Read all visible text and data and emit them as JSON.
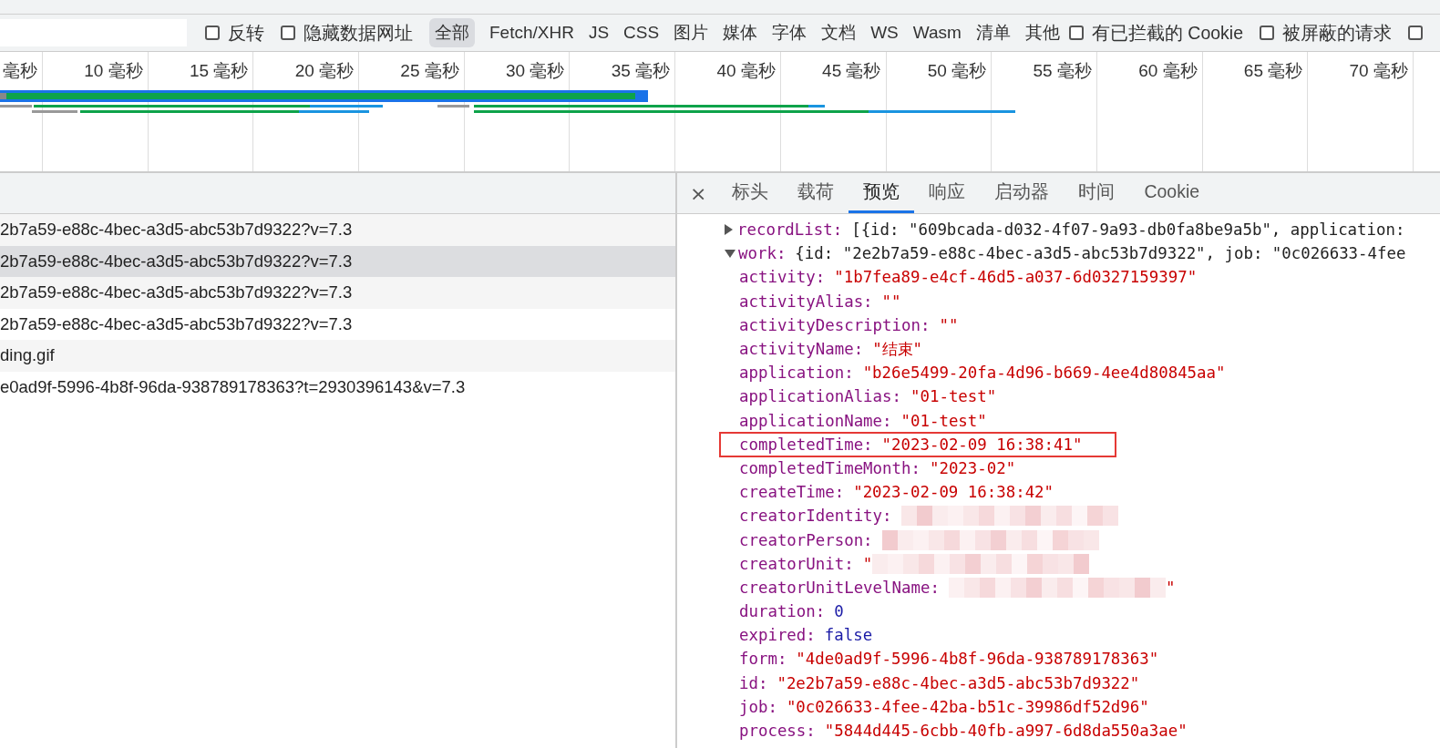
{
  "filter_bar": {
    "options": [
      {
        "kind": "checkbox",
        "label": "反转",
        "checked": false
      },
      {
        "kind": "checkbox",
        "label": "隐藏数据网址",
        "checked": false
      },
      {
        "kind": "type",
        "label": "全部",
        "selected": true
      },
      {
        "kind": "type",
        "label": "Fetch/XHR",
        "selected": false
      },
      {
        "kind": "type",
        "label": "JS",
        "selected": false
      },
      {
        "kind": "type",
        "label": "CSS",
        "selected": false
      },
      {
        "kind": "type",
        "label": "图片",
        "selected": false
      },
      {
        "kind": "type",
        "label": "媒体",
        "selected": false
      },
      {
        "kind": "type",
        "label": "字体",
        "selected": false
      },
      {
        "kind": "type",
        "label": "文档",
        "selected": false
      },
      {
        "kind": "type",
        "label": "WS",
        "selected": false
      },
      {
        "kind": "type",
        "label": "Wasm",
        "selected": false
      },
      {
        "kind": "type",
        "label": "清单",
        "selected": false
      },
      {
        "kind": "type",
        "label": "其他",
        "selected": false
      },
      {
        "kind": "checkbox",
        "label": "有已拦截的 Cookie",
        "checked": false
      },
      {
        "kind": "checkbox",
        "label": "被屏蔽的请求",
        "checked": false
      },
      {
        "kind": "checkbox",
        "checked": false
      }
    ]
  },
  "timeline": {
    "ticks": [
      "毫秒",
      "10 毫秒",
      "15 毫秒",
      "20 毫秒",
      "25 毫秒",
      "30 毫秒",
      "35 毫秒",
      "40 毫秒",
      "45 毫秒",
      "50 毫秒",
      "55 毫秒",
      "60 毫秒",
      "65 毫秒",
      "70 毫秒"
    ]
  },
  "requests": [
    {
      "name": "2b7a59-e88c-4bec-a3d5-abc53b7d9322?v=7.3",
      "selected": false
    },
    {
      "name": "2b7a59-e88c-4bec-a3d5-abc53b7d9322?v=7.3",
      "selected": true
    },
    {
      "name": "2b7a59-e88c-4bec-a3d5-abc53b7d9322?v=7.3",
      "selected": false
    },
    {
      "name": "2b7a59-e88c-4bec-a3d5-abc53b7d9322?v=7.3",
      "selected": false
    },
    {
      "name": "ding.gif",
      "selected": false
    },
    {
      "name": "e0ad9f-5996-4b8f-96da-938789178363?t=2930396143&v=7.3",
      "selected": false
    }
  ],
  "detail_tabs": {
    "close": "×",
    "tabs": [
      {
        "label": "标头",
        "selected": false
      },
      {
        "label": "载荷",
        "selected": false
      },
      {
        "label": "预览",
        "selected": true
      },
      {
        "label": "响应",
        "selected": false
      },
      {
        "label": "启动器",
        "selected": false
      },
      {
        "label": "时间",
        "selected": false
      },
      {
        "label": "Cookie",
        "selected": false
      }
    ]
  },
  "preview": [
    {
      "key": "recordList:",
      "value": "[{id: \"609bcada-d032-4f07-9a93-db0fa8be9a5b\", application:",
      "expanded": false
    },
    {
      "key": "work:",
      "value": "{id: \"2e2b7a59-e88c-4bec-a3d5-abc53b7d9322\", job: \"0c026633-4fee",
      "expanded": true,
      "children": [
        {
          "key": "activity:",
          "kind": "string",
          "value": "\"1b7fea89-e4cf-46d5-a037-6d0327159397\""
        },
        {
          "key": "activityAlias:",
          "kind": "string",
          "value": "\"\""
        },
        {
          "key": "activityDescription:",
          "kind": "string",
          "value": "\"\""
        },
        {
          "key": "activityName:",
          "kind": "string",
          "value": "\"结束\""
        },
        {
          "key": "application:",
          "kind": "string",
          "value": "\"b26e5499-20fa-4d96-b669-4ee4d80845aa\""
        },
        {
          "key": "applicationAlias:",
          "kind": "string",
          "value": "\"01-test\""
        },
        {
          "key": "applicationName:",
          "kind": "string",
          "value": "\"01-test\""
        },
        {
          "key": "completedTime:",
          "kind": "string",
          "value": "\"2023-02-09 16:38:41\"",
          "highlighted": true
        },
        {
          "key": "completedTimeMonth:",
          "kind": "string",
          "value": "\"2023-02\""
        },
        {
          "key": "createTime:",
          "kind": "string",
          "value": "\"2023-02-09 16:38:42\""
        },
        {
          "key": "creatorIdentity:",
          "kind": "redacted"
        },
        {
          "key": "creatorPerson:",
          "kind": "redacted"
        },
        {
          "key": "creatorUnit:",
          "kind": "redacted",
          "value": "\""
        },
        {
          "key": "creatorUnitLevelName:",
          "kind": "redacted",
          "value_end": "\""
        },
        {
          "key": "duration:",
          "kind": "number",
          "value": "0"
        },
        {
          "key": "expired:",
          "kind": "number",
          "value": "false"
        },
        {
          "key": "form:",
          "kind": "string",
          "value": "\"4de0ad9f-5996-4b8f-96da-938789178363\""
        },
        {
          "key": "id:",
          "kind": "string",
          "value": "\"2e2b7a59-e88c-4bec-a3d5-abc53b7d9322\""
        },
        {
          "key": "job:",
          "kind": "string",
          "value": "\"0c026633-4fee-42ba-b51c-39986df52d96\""
        },
        {
          "key": "process:",
          "kind": "string",
          "value": "\"5844d445-6cbb-40fb-a997-6d8da550a3ae\""
        }
      ]
    }
  ]
}
